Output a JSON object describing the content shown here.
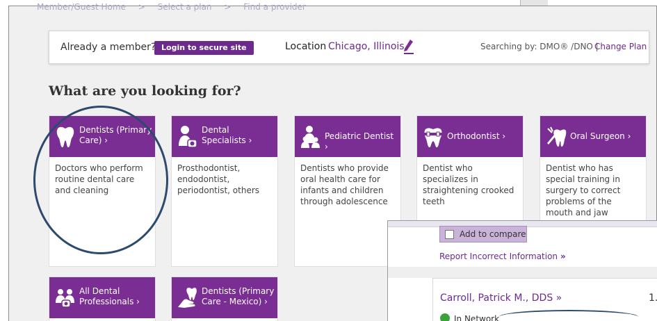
{
  "breadcrumbs": [
    "Member/Guest Home",
    ">",
    "Select a plan",
    ">",
    "Find a provider"
  ],
  "member_bar": {
    "already_member": "Already a member?",
    "login_button": "Login to secure site",
    "location_label": "Location",
    "location_value": "Chicago, Illinois",
    "searching_by": "Searching by: DMO® /DNO |",
    "change_plan": "Change Plan"
  },
  "heading": "What are you looking for?",
  "categories": [
    {
      "title": "Dentists (Primary Care) ›",
      "description": "Doctors who perform routine dental care and cleaning",
      "icon": "tooth-icon"
    },
    {
      "title": "Dental Specialists ›",
      "description": "Prosthodontist, endodontist, periodontist, others",
      "icon": "dental-specialist-icon"
    },
    {
      "title": "Pediatric Dentist ›",
      "description": "Dentists who provide oral health care for infants and children through adolescence",
      "icon": "family-icon"
    },
    {
      "title": "Orthodontist ›",
      "description": "Dentist who specializes in straightening crooked teeth",
      "icon": "braces-tooth-icon"
    },
    {
      "title": "Oral Surgeon ›",
      "description": "Dentist who has special training in surgery to correct problems of the mouth and jaw",
      "icon": "surgical-tooth-icon"
    },
    {
      "title": "All Dental Professionals ›",
      "description": "",
      "icon": "group-icon"
    },
    {
      "title": "Dentists (Primary Care - Mexico) ›",
      "description": "",
      "icon": "hand-tooth-icon"
    }
  ],
  "overlay": {
    "add_to_compare": "Add to compare",
    "report_link": "Report Incorrect Information",
    "report_arrow": "»",
    "provider_name": "Carroll, Patrick M., DDS »",
    "provider_number": "1.",
    "network_status": "In Network"
  },
  "colors": {
    "brand_purple": "#7a2e93",
    "link_purple": "#6b2a8c",
    "annotation_ellipse": "#2d4a6e",
    "in_network_green": "#3ea23c"
  }
}
